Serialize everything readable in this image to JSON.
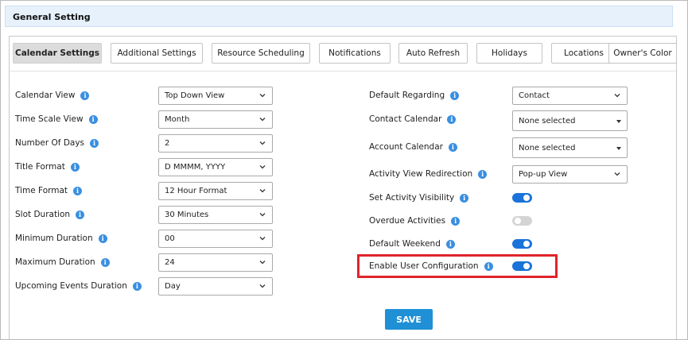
{
  "header": {
    "title": "General Setting"
  },
  "tabs": [
    {
      "label": "Calendar Settings",
      "active": true
    },
    {
      "label": "Additional Settings",
      "active": false
    },
    {
      "label": "Resource Scheduling",
      "active": false
    },
    {
      "label": "Notifications",
      "active": false
    },
    {
      "label": "Auto Refresh",
      "active": false
    },
    {
      "label": "Holidays",
      "active": false
    },
    {
      "label": "Locations",
      "active": false
    },
    {
      "label": "Owner's Color",
      "active": false
    }
  ],
  "left_fields": [
    {
      "label": "Calendar View",
      "value": "Top Down View"
    },
    {
      "label": "Time Scale View",
      "value": "Month"
    },
    {
      "label": "Number Of Days",
      "value": "2"
    },
    {
      "label": "Title Format",
      "value": "D MMMM, YYYY"
    },
    {
      "label": "Time Format",
      "value": "12 Hour Format"
    },
    {
      "label": "Slot Duration",
      "value": "30 Minutes"
    },
    {
      "label": "Minimum Duration",
      "value": "00"
    },
    {
      "label": "Maximum Duration",
      "value": "24"
    },
    {
      "label": "Upcoming Events Duration",
      "value": "Day"
    }
  ],
  "right_fields": [
    {
      "label": "Default Regarding",
      "value": "Contact"
    },
    {
      "label": "Contact Calendar",
      "value": "None selected"
    },
    {
      "label": "Account Calendar",
      "value": "None selected"
    },
    {
      "label": "Activity View Redirection",
      "value": "Pop-up View"
    }
  ],
  "toggles": [
    {
      "label": "Set Activity Visibility",
      "on": true
    },
    {
      "label": "Overdue Activities",
      "on": false
    },
    {
      "label": "Default Weekend",
      "on": true
    },
    {
      "label": "Enable User Configuration",
      "on": true
    }
  ],
  "save_label": "SAVE",
  "colors": {
    "accent": "#1f90d6",
    "toggle_on": "#1a73d9",
    "highlight": "#e0242b"
  },
  "icons": {
    "info": "info-icon",
    "dropdown": "chevron-down-icon",
    "caret": "caret-down-icon"
  }
}
